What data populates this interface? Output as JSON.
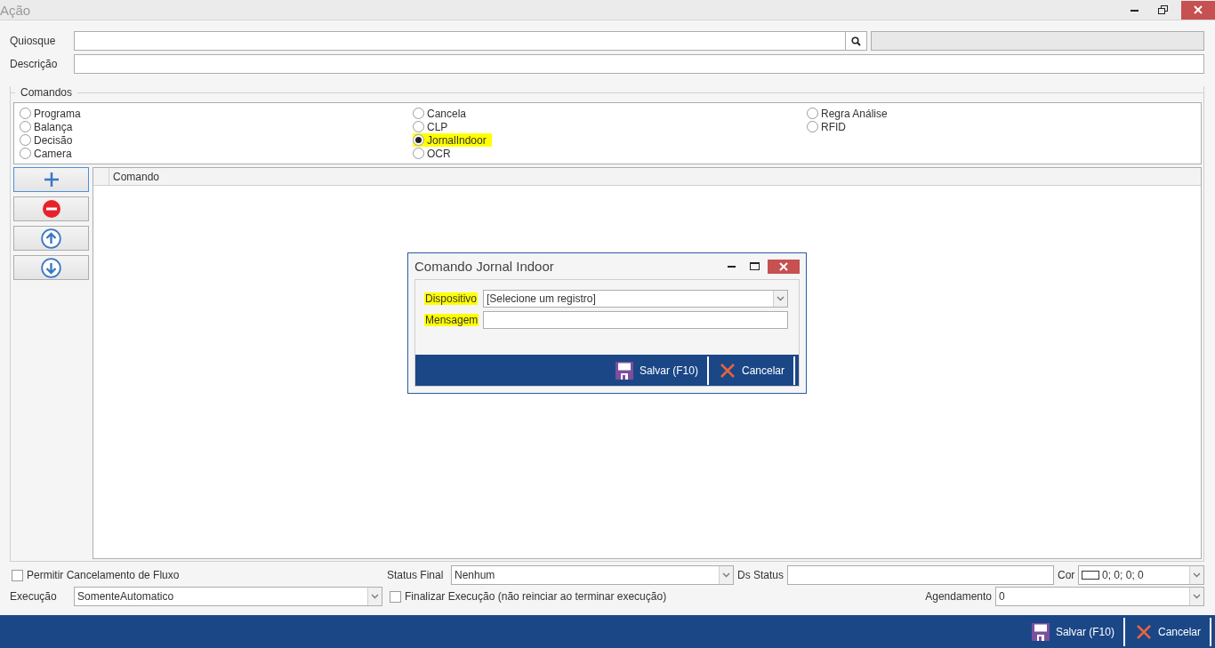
{
  "window": {
    "title": "Ação"
  },
  "quiosque": {
    "label": "Quiosque"
  },
  "descricao": {
    "label": "Descrição"
  },
  "commands": {
    "title": "Comandos",
    "columns": [
      {
        "options": [
          {
            "label": "Programa",
            "selected": false,
            "highlighted": false
          },
          {
            "label": "Balança",
            "selected": false,
            "highlighted": false
          },
          {
            "label": "Decisão",
            "selected": false,
            "highlighted": false
          },
          {
            "label": "Camera",
            "selected": false,
            "highlighted": false
          }
        ]
      },
      {
        "options": [
          {
            "label": "Cancela",
            "selected": false,
            "highlighted": false
          },
          {
            "label": "CLP",
            "selected": false,
            "highlighted": false
          },
          {
            "label": "JornalIndoor",
            "selected": true,
            "highlighted": true
          },
          {
            "label": "OCR",
            "selected": false,
            "highlighted": false
          }
        ]
      },
      {
        "options": [
          {
            "label": "Regra Análise",
            "selected": false,
            "highlighted": false
          },
          {
            "label": "RFID",
            "selected": false,
            "highlighted": false
          }
        ]
      }
    ]
  },
  "side_buttons": [
    {
      "kind": "add"
    },
    {
      "kind": "remove"
    },
    {
      "kind": "up"
    },
    {
      "kind": "down"
    }
  ],
  "grid": {
    "columns": [
      "Comando"
    ]
  },
  "dialog": {
    "title": "Comando Jornal Indoor",
    "fields": [
      {
        "kind": "select",
        "label": "Dispositivo",
        "value": "[Selecione um registro]",
        "highlighted": true
      },
      {
        "kind": "text",
        "label": "Mensagem",
        "highlighted": true
      }
    ],
    "buttons": [
      {
        "kind": "save",
        "label": "Salvar (F10)"
      },
      {
        "kind": "cancel",
        "label": "Cancelar"
      }
    ]
  },
  "permitir": {
    "label": "Permitir Cancelamento de Fluxo",
    "checked": false
  },
  "status_final": {
    "label": "Status Final",
    "value": "Nenhum"
  },
  "ds_status": {
    "label": "Ds Status"
  },
  "cor": {
    "label": "Cor",
    "value": "0; 0; 0; 0"
  },
  "execucao": {
    "label": "Execução",
    "value": "SomenteAutomatico"
  },
  "finalizar": {
    "label": "Finalizar Execução (não reinciar ao terminar execução)",
    "checked": false
  },
  "agendamento": {
    "label": "Agendamento",
    "value": "0"
  },
  "footer": {
    "buttons": [
      {
        "kind": "save",
        "label": "Salvar (F10)"
      },
      {
        "kind": "cancel",
        "label": "Cancelar"
      }
    ]
  }
}
